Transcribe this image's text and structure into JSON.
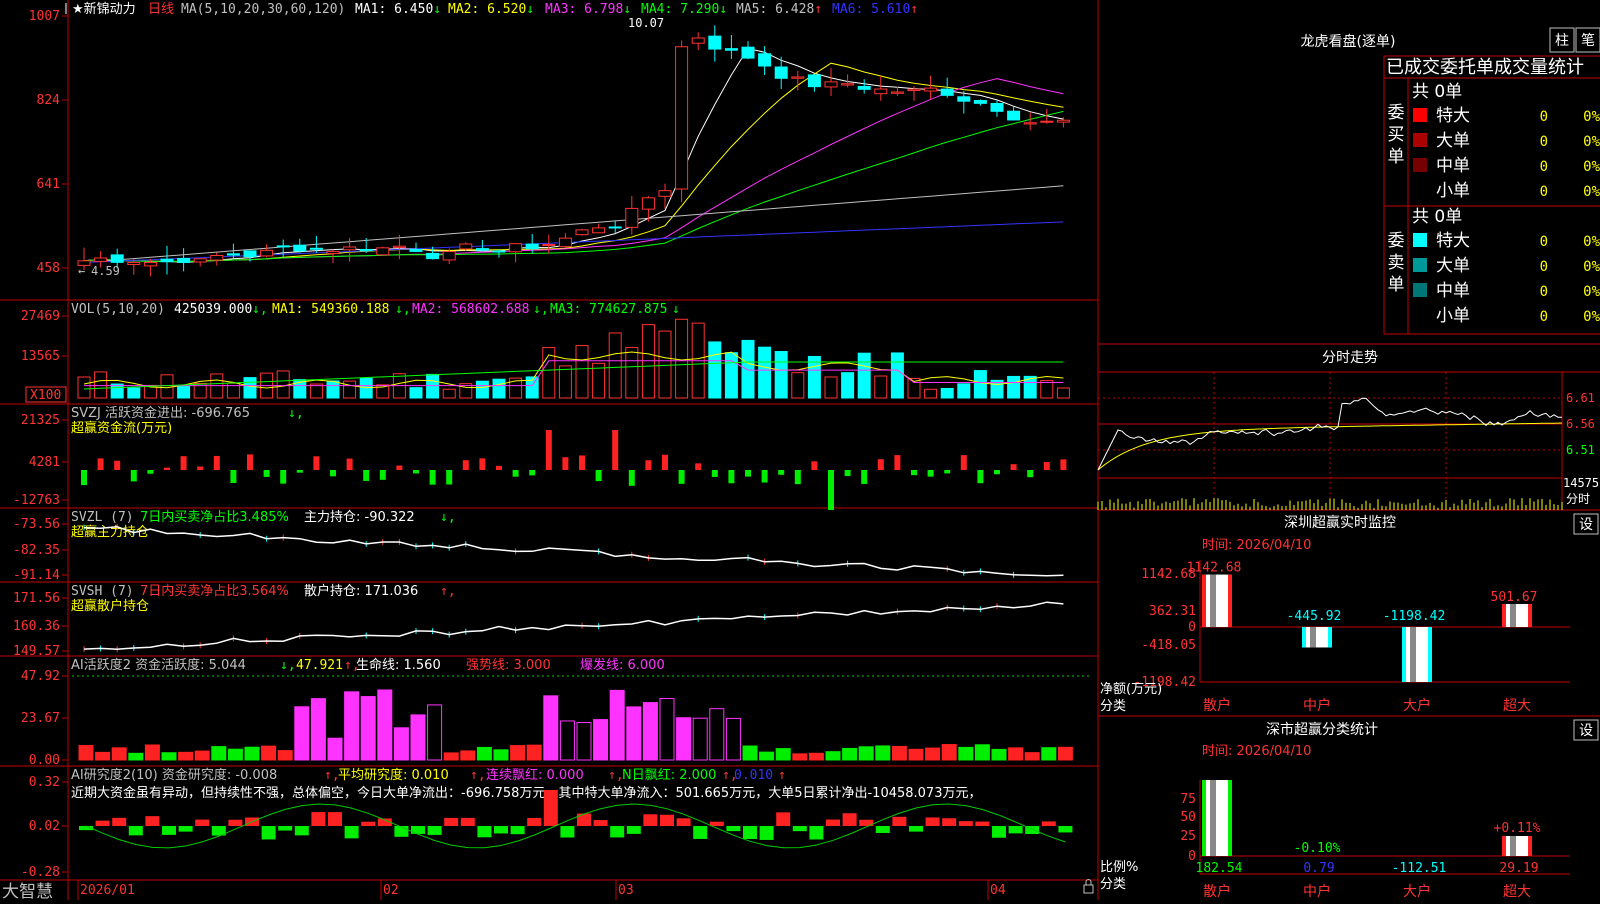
{
  "app_title": "大智慧",
  "stock": {
    "name": "★新锦动力",
    "period": "日线",
    "ma_label": "MA(5,10,20,30,60,120)",
    "ma": [
      {
        "label": "MA1: 6.450",
        "arrow": "↓",
        "color": "#ffffff"
      },
      {
        "label": "MA2: 6.520",
        "arrow": "↓",
        "color": "#ffff00"
      },
      {
        "label": "MA3: 6.798",
        "arrow": "↓",
        "color": "#ff33ff"
      },
      {
        "label": "MA4: 7.290",
        "arrow": "↓",
        "color": "#00ff00"
      },
      {
        "label": "MA5: 6.428",
        "arrow": "↑",
        "color": "#c0c0c0"
      },
      {
        "label": "MA6: 5.610",
        "arrow": "↑",
        "color": "#3333ff"
      }
    ],
    "price_axis": [
      "1007",
      "824",
      "641",
      "458"
    ],
    "high_label": "10.07",
    "low_label": "4.59"
  },
  "vol": {
    "header": "VOL(5,10,20)",
    "value": "425039.000",
    "ma1": "MA1: 549360.188",
    "ma2": "MA2: 568602.688",
    "ma3": "MA3: 774627.875",
    "axis": [
      "27469",
      "13565"
    ],
    "unit": "X100"
  },
  "svzj": {
    "header": "SVZJ  活跃资金进出: -696.765",
    "sub": "超赢资金流(万元)",
    "axis": [
      "21325",
      "4281",
      "-12763"
    ]
  },
  "svzl": {
    "header": "SVZL (7)",
    "mid": "7日内买卖净占比3.485%",
    "tail": "主力持仓: -90.322",
    "sub": "超赢主力持仓",
    "axis": [
      "-73.56",
      "-82.35",
      "-91.14"
    ]
  },
  "svsh": {
    "header": "SVSH (7)",
    "mid": "7日内买卖净占比3.564%",
    "tail": "散户持仓: 171.036",
    "sub": "超赢散户持仓",
    "axis": [
      "171.56",
      "160.36",
      "149.57"
    ]
  },
  "ai1": {
    "header": "AI活跃度2 资金活跃度: 5.044",
    "v2": "47.921",
    "v3": "生命线: 1.560",
    "v4": "强势线: 3.000",
    "v5": "爆发线: 6.000",
    "axis": [
      "47.92",
      "23.67",
      "0.00"
    ]
  },
  "ai2": {
    "header": "AI研究度2(10) 资金研究度: -0.008",
    "v2": "平均研究度: 0.010",
    "v3": "连续飘红: 0.000",
    "v4": "N日飘红: 2.000",
    "v5": "0.010",
    "comment": "近期大资金虽有异动，但持续性不强，总体偏空，今日大单净流出：-696.758万元，其中特大单净流入：501.665万元，大单5日累计净出-10458.073万元，",
    "axis": [
      "0.32",
      "0.02",
      "-0.28"
    ]
  },
  "dates": [
    "2026/01",
    "02",
    "03",
    "04"
  ],
  "dragon": {
    "title": "龙虎看盘(逐单)",
    "btn_bar": "柱",
    "btn_tick": "笔",
    "subtitle": "已成交委托单成交量统计",
    "buy_label": "委买单",
    "sell_label": "委卖单",
    "buy_total": "共 0单",
    "sell_total": "共 0单",
    "buy_rows": [
      {
        "label": "特大",
        "val": "0",
        "pct": "0%",
        "color": "#ff0000"
      },
      {
        "label": "大单",
        "val": "0",
        "pct": "0%",
        "color": "#aa0000"
      },
      {
        "label": "中单",
        "val": "0",
        "pct": "0%",
        "color": "#770000"
      },
      {
        "label": "小单",
        "val": "0",
        "pct": "0%",
        "color": "#000000"
      }
    ],
    "sell_rows": [
      {
        "label": "特大",
        "val": "0",
        "pct": "0%",
        "color": "#00ffff"
      },
      {
        "label": "大单",
        "val": "0",
        "pct": "0%",
        "color": "#009999"
      },
      {
        "label": "中单",
        "val": "0",
        "pct": "0%",
        "color": "#007777"
      },
      {
        "label": "小单",
        "val": "0",
        "pct": "0%",
        "color": "#000000"
      }
    ]
  },
  "intraday": {
    "title": "分时走势",
    "axis": [
      "6.61",
      "6.56",
      "6.51"
    ],
    "vol_label": "14575",
    "unit": "分时"
  },
  "sz_monitor": {
    "title": "深圳超赢实时监控",
    "btn": "设",
    "time": "时间: 2026/04/10",
    "axis": [
      "1142.68",
      "362.31",
      "0",
      "-418.05",
      "-1198.42"
    ],
    "ylabel1": "净额(万元)",
    "ylabel2": "分类",
    "categories": [
      "散户",
      "中户",
      "大户",
      "超大"
    ],
    "values": [
      "1142.68",
      "-445.92",
      "-1198.42",
      "501.67"
    ]
  },
  "sz_class": {
    "title": "深市超赢分类统计",
    "btn": "设",
    "time": "时间: 2026/04/10",
    "axis": [
      "75",
      "50",
      "25",
      "0"
    ],
    "ylabel1": "比例%",
    "ylabel2": "分类",
    "categories": [
      "散户",
      "中户",
      "大户",
      "超大"
    ],
    "pct_labels": [
      "-0.10%",
      "+0.11%"
    ],
    "values": [
      "182.54",
      "0.79",
      "-112.51",
      "29.19"
    ]
  }
}
